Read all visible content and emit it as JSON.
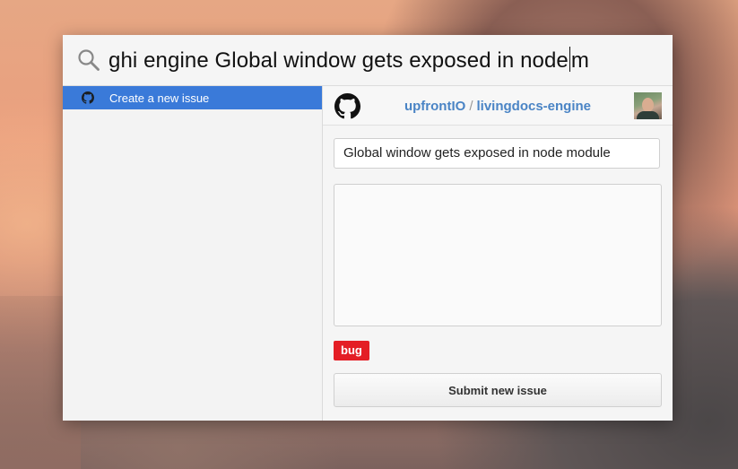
{
  "search": {
    "query_before_caret": "ghi engine Global window gets exposed in node",
    "query_after_caret": "m"
  },
  "results": {
    "items": [
      {
        "label": "Create a new issue",
        "icon": "github-icon",
        "selected": true
      }
    ]
  },
  "issue_form": {
    "repo_owner": "upfrontIO",
    "repo_separator": "/",
    "repo_name": "livingdocs-engine",
    "title_value": "Global window gets exposed in node module",
    "body_value": "",
    "label": "bug",
    "label_color": "#e41e25",
    "submit_label": "Submit new issue"
  },
  "colors": {
    "selection": "#3a7ad9",
    "repo_link": "#4a84c5"
  }
}
